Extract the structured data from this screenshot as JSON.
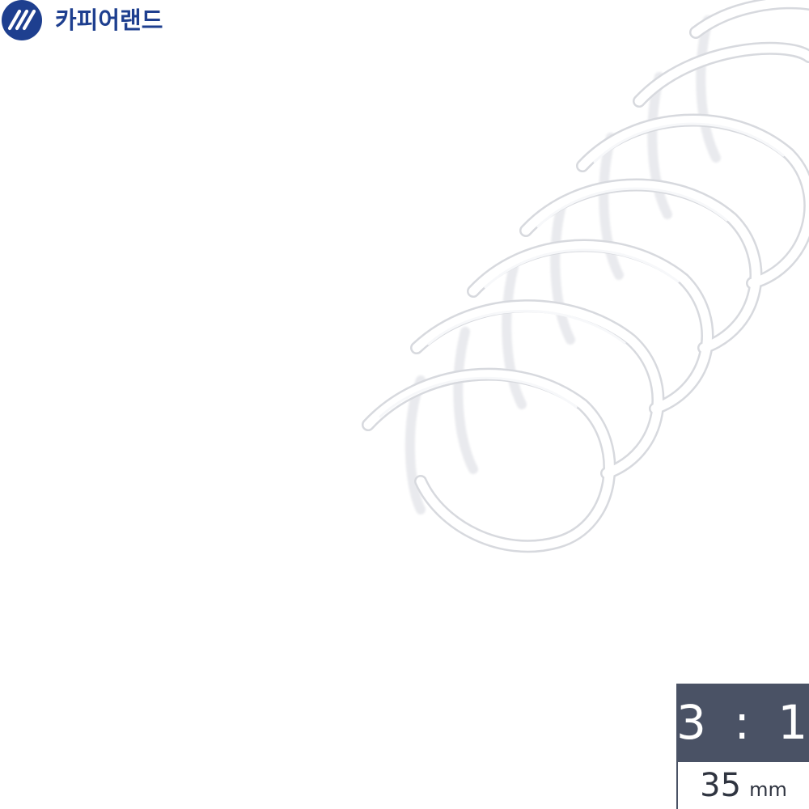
{
  "brand": {
    "name": "카피어랜드",
    "logo_icon": "slanted-stripes-logo-icon",
    "color": "#1e3f8f"
  },
  "product_image": {
    "subject": "white-spiral-binding-coil",
    "coil_color": "#ffffff"
  },
  "spec_badge": {
    "pitch_ratio": "3 : 1",
    "size_value": "35",
    "size_unit": "mm",
    "badge_color": "#4a5265"
  }
}
